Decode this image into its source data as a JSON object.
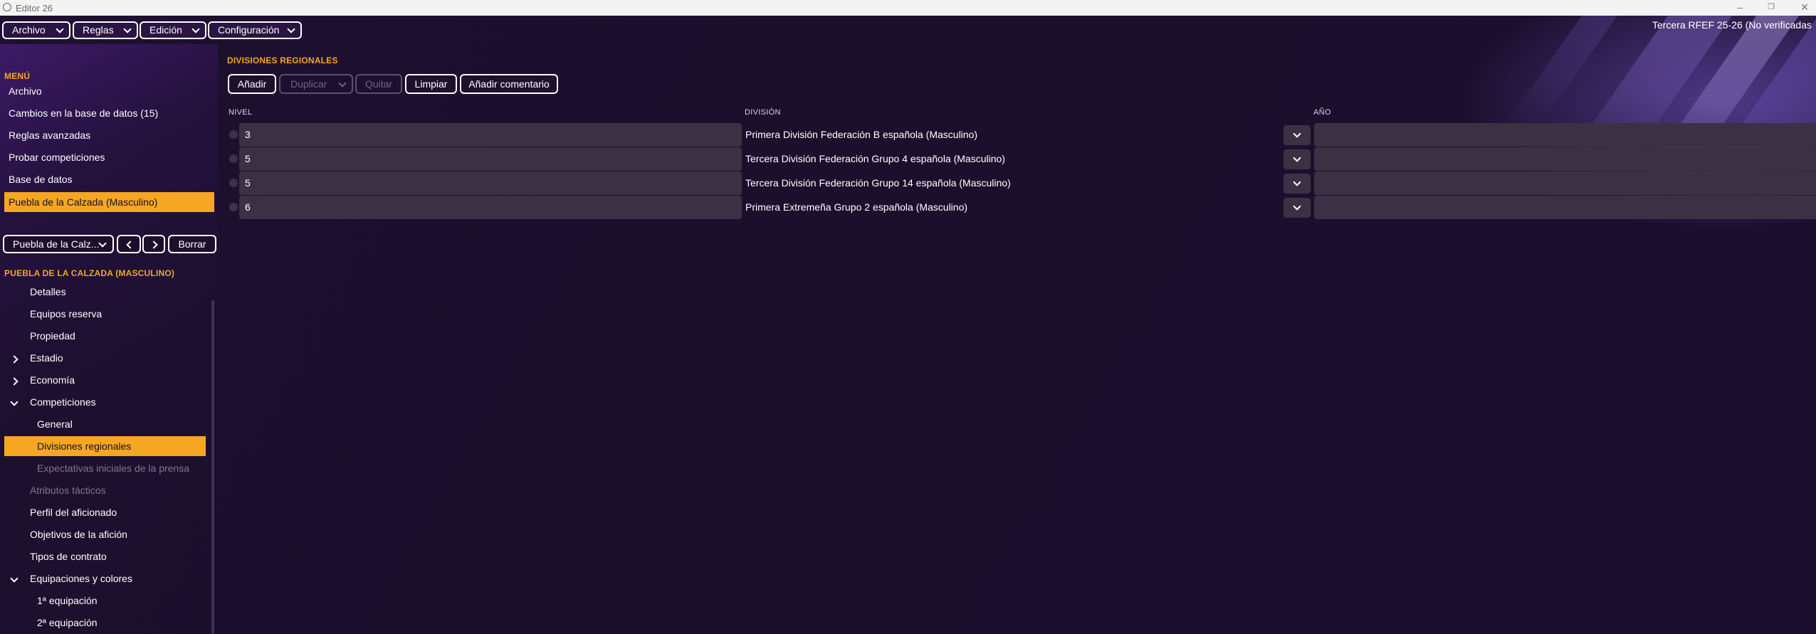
{
  "window": {
    "title": "Editor 26",
    "controls": [
      "minimize",
      "restore",
      "close"
    ]
  },
  "topbar": {
    "menus": [
      {
        "label": "Archivo"
      },
      {
        "label": "Reglas"
      },
      {
        "label": "Edición"
      },
      {
        "label": "Configuración"
      }
    ],
    "status": "Tercera RFEF 25-26 (No verificadas"
  },
  "sidebar": {
    "menu_title": "MENÚ",
    "menu_items": [
      {
        "label": "Archivo",
        "active": false
      },
      {
        "label": "Cambios en la base de datos (15)",
        "active": false
      },
      {
        "label": "Reglas avanzadas",
        "active": false
      },
      {
        "label": "Probar competiciones",
        "active": false
      },
      {
        "label": "Base de datos",
        "active": false
      },
      {
        "label": "Puebla de la Calzada (Masculino)",
        "active": true
      }
    ],
    "nav": {
      "selected": "Puebla de la Calz...",
      "clear_label": "Borrar"
    },
    "club_title": "PUEBLA DE LA CALZADA (MASCULINO)",
    "tree": [
      {
        "label": "Detalles",
        "level": 0,
        "expander": "none",
        "state": "normal"
      },
      {
        "label": "Equipos reserva",
        "level": 0,
        "expander": "none",
        "state": "normal"
      },
      {
        "label": "Propiedad",
        "level": 0,
        "expander": "none",
        "state": "normal"
      },
      {
        "label": "Estadio",
        "level": 0,
        "expander": "collapsed",
        "state": "normal"
      },
      {
        "label": "Economía",
        "level": 0,
        "expander": "collapsed",
        "state": "normal"
      },
      {
        "label": "Competiciones",
        "level": 0,
        "expander": "expanded",
        "state": "normal"
      },
      {
        "label": "General",
        "level": 1,
        "expander": "none",
        "state": "normal"
      },
      {
        "label": "Divisiones regionales",
        "level": 1,
        "expander": "none",
        "state": "active"
      },
      {
        "label": "Expectativas iniciales de la prensa",
        "level": 1,
        "expander": "none",
        "state": "disabled"
      },
      {
        "label": "Atributos tácticos",
        "level": 0,
        "expander": "none",
        "state": "disabled"
      },
      {
        "label": "Perfil del aficionado",
        "level": 0,
        "expander": "none",
        "state": "normal"
      },
      {
        "label": "Objetivos de la afición",
        "level": 0,
        "expander": "none",
        "state": "normal"
      },
      {
        "label": "Tipos de contrato",
        "level": 0,
        "expander": "none",
        "state": "normal"
      },
      {
        "label": "Equipaciones y colores",
        "level": 0,
        "expander": "expanded",
        "state": "normal"
      },
      {
        "label": "1ª equipación",
        "level": 1,
        "expander": "none",
        "state": "normal"
      },
      {
        "label": "2ª equipación",
        "level": 1,
        "expander": "none",
        "state": "normal"
      }
    ]
  },
  "main": {
    "title": "DIVISIONES REGIONALES",
    "toolbar": [
      {
        "label": "Añadir",
        "enabled": true,
        "dropdown": false
      },
      {
        "label": "Duplicar",
        "enabled": false,
        "dropdown": true
      },
      {
        "label": "Quitar",
        "enabled": false,
        "dropdown": false
      },
      {
        "label": "Limpiar",
        "enabled": true,
        "dropdown": false
      },
      {
        "label": "Añadir comentario",
        "enabled": true,
        "dropdown": false
      }
    ],
    "columns": {
      "nivel": "NIVEL",
      "division": "DIVISIÓN",
      "anio": "AÑO"
    },
    "rows": [
      {
        "nivel": "3",
        "division": "Primera División Federación B española (Masculino)",
        "anio": ""
      },
      {
        "nivel": "5",
        "division": "Tercera División Federación Grupo 4 española (Masculino)",
        "anio": ""
      },
      {
        "nivel": "5",
        "division": "Tercera División Federación Grupo 14 española (Masculino)",
        "anio": ""
      },
      {
        "nivel": "6",
        "division": "Primera Extremeña Grupo 2 española (Masculino)",
        "anio": ""
      }
    ]
  },
  "colors": {
    "accent": "#f5a623",
    "background": "#1b0f2c",
    "field": "#3a3244"
  }
}
